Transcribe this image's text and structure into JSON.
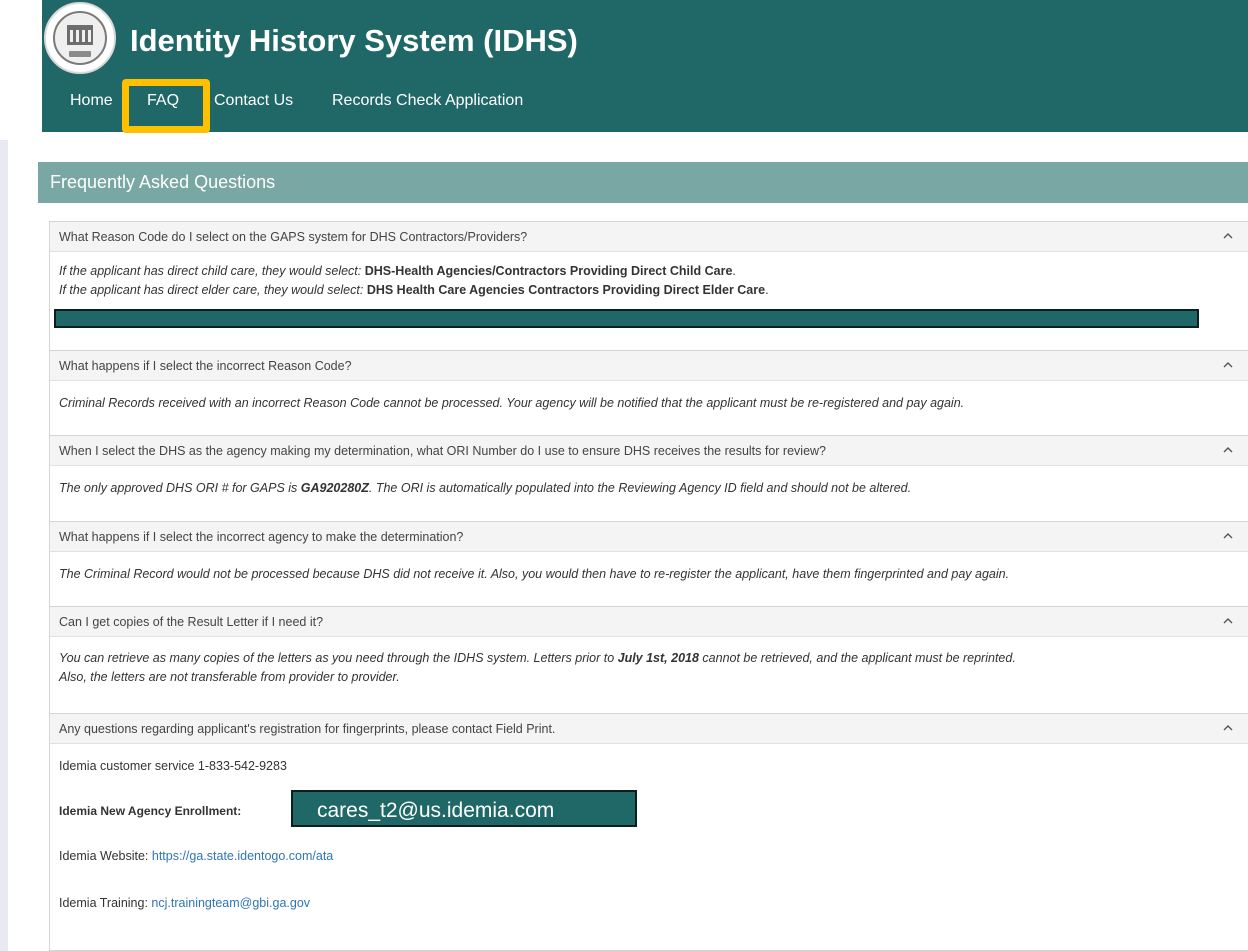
{
  "header": {
    "title": "Identity History System (IDHS)",
    "seal_icon": "state-seal-icon"
  },
  "nav": {
    "items": [
      {
        "label": "Home"
      },
      {
        "label": "FAQ",
        "highlighted": true
      },
      {
        "label": "Contact Us"
      },
      {
        "label": "Records Check Application"
      }
    ]
  },
  "panel": {
    "title": "Frequently Asked Questions"
  },
  "faqs": [
    {
      "question": "What Reason Code do I select on the GAPS system for DHS Contractors/Providers?",
      "line1_prefix": "If the applicant has direct child care, they would select: ",
      "line1_bold": "DHS-Health Agencies/Contractors Providing Direct Child Care",
      "line2_prefix": "If the applicant has direct elder care, they would select: ",
      "line2_bold": "DHS Health Care Agencies Contractors Providing Direct Elder Care",
      "period": "."
    },
    {
      "question": "What happens if I select the incorrect Reason Code?",
      "answer": "Criminal Records received with an incorrect Reason Code cannot be processed. Your agency will be notified that the applicant must be re-registered and pay again."
    },
    {
      "question": "When I select the DHS as the agency making my determination, what ORI Number do I use to ensure DHS receives the results for review?",
      "answer_prefix": "The only approved DHS ORI # for GAPS is ",
      "answer_bold": "GA920280Z",
      "answer_suffix": ". The ORI is automatically populated into the Reviewing Agency ID field and should not be altered."
    },
    {
      "question": "What happens if I select the incorrect agency to make the determination?",
      "answer": "The Criminal Record would not be processed because DHS did not receive it. Also, you would then have to re-register the applicant, have them fingerprinted and pay again."
    },
    {
      "question": "Can I get copies of the Result Letter if I need it?",
      "answer_prefix": "You can retrieve as many copies of the letters as you need through the IDHS system. Letters prior to ",
      "answer_bold": "July 1st, 2018",
      "answer_suffix": " cannot be retrieved, and the applicant must be reprinted.",
      "answer_line2": "Also, the letters are not transferable from provider to provider."
    },
    {
      "question": "Any questions regarding applicant's registration for fingerprints, please contact Field Print.",
      "customer_service": "Idemia customer service 1-833-542-9283",
      "enrollment_label": "Idemia New Agency Enrollment:",
      "enrollment_email": "cares_t2@us.idemia.com",
      "website_label": "Idemia Website: ",
      "website_link": "https://ga.state.identogo.com/ata",
      "training_label": "Idemia Training: ",
      "training_link": "ncj.trainingteam@gbi.ga.gov"
    }
  ],
  "colors": {
    "header_bg": "#1f6867",
    "panel_header_bg": "#78a7a4",
    "highlight": "#ffc000",
    "link": "#2f75b5"
  }
}
